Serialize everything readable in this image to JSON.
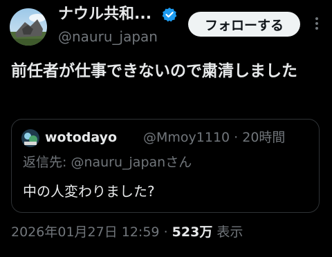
{
  "author": {
    "display_name": "ナウル共和...",
    "handle": "@nauru_japan",
    "verified_icon": "verified-badge-icon",
    "follow_label": "フォローする"
  },
  "tweet": {
    "text": "前任者が仕事できないので粛清しました"
  },
  "quote": {
    "display_name": "wotodayo",
    "meta": "@Mmoy1110 · 20時間",
    "reply_to": "返信先: @nauru_japanさん",
    "text": "中の人変わりました?"
  },
  "footer": {
    "timestamp": "2026年01月27日 12:59",
    "separator": "·",
    "views_count": "523万",
    "views_label": "表示"
  },
  "colors": {
    "background": "#000000",
    "text_primary": "#e7e9ea",
    "text_secondary": "#71767b",
    "verified_blue": "#1d9bf0",
    "border": "#2f3336",
    "follow_button_bg": "#eff3f4"
  }
}
